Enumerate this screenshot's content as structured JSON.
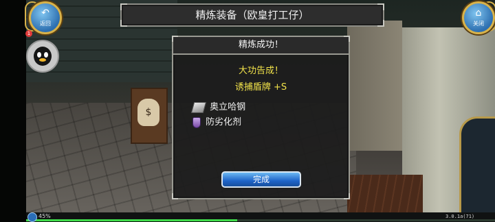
{
  "header": {
    "title": "精炼装备（欧皇打工仔）",
    "back_button": {
      "label": "返回",
      "icon": "back-arrow-icon"
    },
    "close_button": {
      "label": "关闭",
      "icon": "home-icon"
    }
  },
  "player": {
    "avatar_icon": "penguin-avatar-icon",
    "notification_count": "1"
  },
  "dialog": {
    "title": "精炼成功！",
    "headline": "大功告成！",
    "result": "诱捕盾牌 +S",
    "materials": [
      {
        "name": "奥立哈钢",
        "icon": "ingot-icon"
      },
      {
        "name": "防劣化剂",
        "icon": "potion-icon"
      }
    ],
    "done_label": "完成"
  },
  "status": {
    "progress_text": "45%",
    "progress_value": 0.45,
    "version": "3.0.1a(71)"
  },
  "colors": {
    "headline": "#f2e34a",
    "button_blue": "#1e63c8",
    "frame_gold": "#d8b24a",
    "progress": "#3fdc4a"
  }
}
